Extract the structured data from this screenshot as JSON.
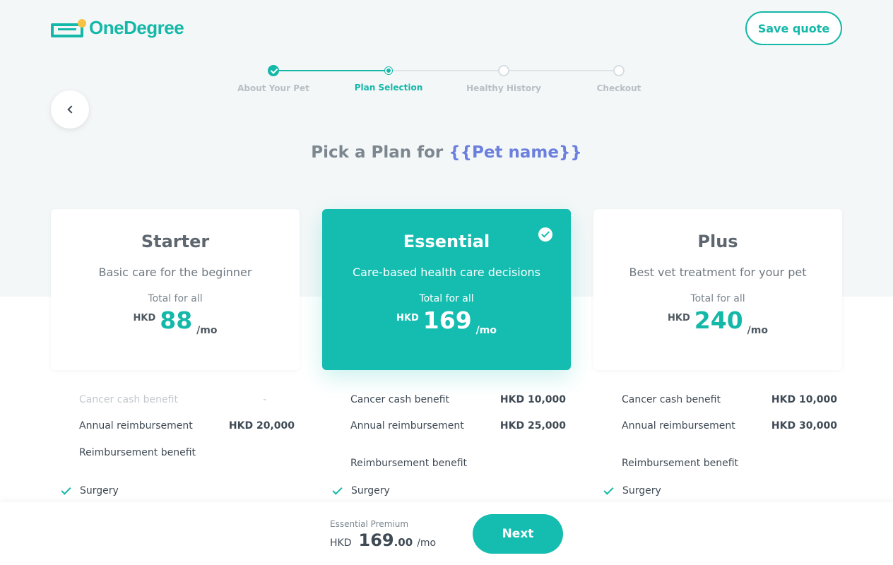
{
  "brand": {
    "name": "OneDegree",
    "icon": "onedegree-logo-icon",
    "accent": "#14b8a8",
    "dot_color": "#f6c344"
  },
  "header": {
    "save_quote_label": "Save quote"
  },
  "stepper": {
    "steps": [
      {
        "label": "About Your Pet",
        "state": "done"
      },
      {
        "label": "Plan Selection",
        "state": "active"
      },
      {
        "label": "Healthy History",
        "state": "pending"
      },
      {
        "label": "Checkout",
        "state": "pending"
      }
    ]
  },
  "nav": {
    "back_icon": "chevron-left-icon"
  },
  "title": {
    "prefix": "Pick a Plan for",
    "pet_placeholder": "{{Pet name}}"
  },
  "plans": [
    {
      "name": "Starter",
      "description": "Basic care for the beginner",
      "total_label": "Total for all",
      "currency": "HKD",
      "amount": "88",
      "period": "/mo",
      "selected": false,
      "benefits": {
        "cancer_label": "Cancer cash benefit",
        "cancer_value": "-",
        "annual_label": "Annual reimbursement",
        "annual_value": "HKD 20,000",
        "reimb_heading": "Reimbursement benefit",
        "item1": "Surgery"
      }
    },
    {
      "name": "Essential",
      "description": "Care-based health care decisions",
      "total_label": "Total for all",
      "currency": "HKD",
      "amount": "169",
      "period": "/mo",
      "selected": true,
      "benefits": {
        "cancer_label": "Cancer cash benefit",
        "cancer_value": "HKD 10,000",
        "annual_label": "Annual reimbursement",
        "annual_value": "HKD 25,000",
        "reimb_heading": "Reimbursement benefit",
        "item1": "Surgery"
      }
    },
    {
      "name": "Plus",
      "description": "Best vet treatment for your pet",
      "total_label": "Total for all",
      "currency": "HKD",
      "amount": "240",
      "period": "/mo",
      "selected": false,
      "benefits": {
        "cancer_label": "Cancer cash benefit",
        "cancer_value": "HKD 10,000",
        "annual_label": "Annual reimbursement",
        "annual_value": "HKD 30,000",
        "reimb_heading": "Reimbursement benefit",
        "item1": "Surgery"
      }
    }
  ],
  "footer": {
    "premium_label": "Essential Premium",
    "currency": "HKD",
    "amount_int": "169",
    "amount_dec": ".00",
    "period": "/mo",
    "next_label": "Next"
  }
}
